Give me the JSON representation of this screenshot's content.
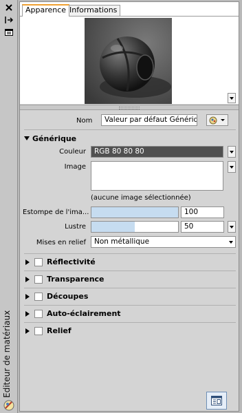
{
  "palette": {
    "title": "Editeur de matériaux"
  },
  "tabs": [
    {
      "label": "Apparence",
      "active": true
    },
    {
      "label": "Informations",
      "active": false
    }
  ],
  "name_label": "Nom",
  "name_value": "Valeur par défaut Génériqu",
  "generic": {
    "header": "Générique",
    "color_label": "Couleur",
    "color_value": "RGB 80 80 80",
    "image_label": "Image",
    "image_caption": "(aucune image sélectionnée)",
    "fade_label": "Estompe de l'ima...",
    "fade_value": "100",
    "fade_level": 100,
    "gloss_label": "Lustre",
    "gloss_value": "50",
    "gloss_level": 50,
    "highlights_label": "Mises en relief",
    "highlights_value": "Non métallique"
  },
  "sections": [
    {
      "label": "Réflectivité"
    },
    {
      "label": "Transparence"
    },
    {
      "label": "Découpes"
    },
    {
      "label": "Auto-éclairement"
    },
    {
      "label": "Relief"
    }
  ],
  "colors": {
    "accent_tab": "#f0a030",
    "color_swatch": "#505050",
    "bar_fill": "#c6dcf0"
  }
}
